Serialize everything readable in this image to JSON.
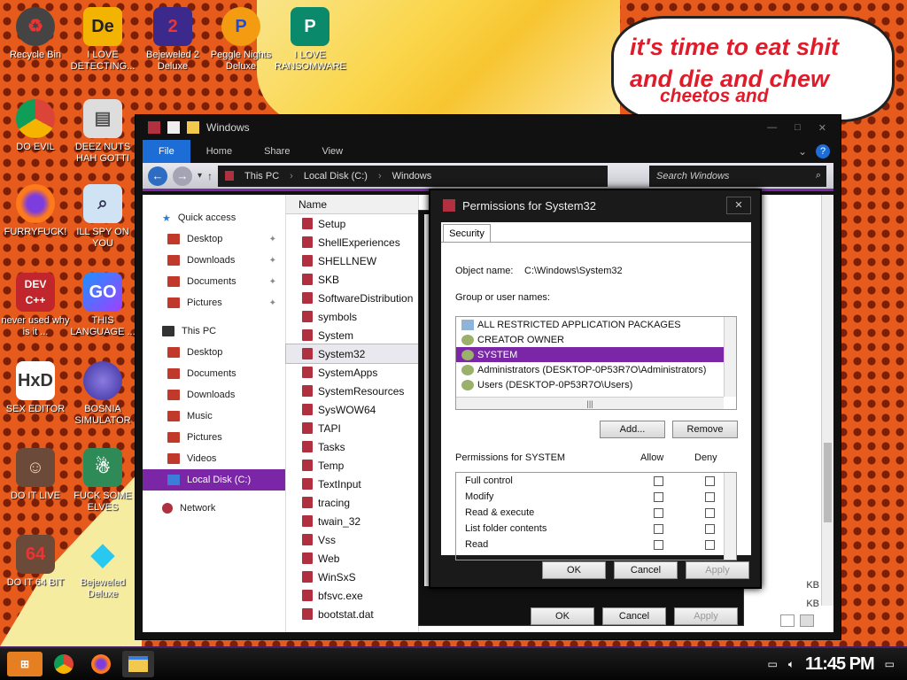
{
  "desktop": {
    "speech_lines": [
      "it's time to eat shit",
      "and die and chew",
      "cheetos and"
    ],
    "icons": [
      {
        "label": "Recycle Bin",
        "icon": "recycle-bin-icon"
      },
      {
        "label": "I LOVE DETECTING...",
        "icon": "detect-it-easy-icon"
      },
      {
        "label": "Bejeweled 2 Deluxe",
        "icon": "bejeweled-2-icon"
      },
      {
        "label": "Peggle Nights Deluxe",
        "icon": "peggle-icon"
      },
      {
        "label": "I LOVE RANSOMWARE",
        "icon": "publisher-icon"
      },
      {
        "label": "DO EVIL",
        "icon": "chrome-icon"
      },
      {
        "label": "DEEZ NUTS HAH GOTTI",
        "icon": "windows-stack-icon"
      },
      {
        "label": "FURRYFUCK!",
        "icon": "firefox-icon"
      },
      {
        "label": "ILL SPY ON YOU",
        "icon": "network-spy-icon"
      },
      {
        "label": "never used why is it ...",
        "icon": "dev-cpp-icon"
      },
      {
        "label": "THIS LANGUAGE ...",
        "icon": "goland-icon"
      },
      {
        "label": "SEX EDITOR",
        "icon": "hxd-icon"
      },
      {
        "label": "BOSNIA SIMULATOR",
        "icon": "mine-icon"
      },
      {
        "label": "DO IT LIVE",
        "icon": "portrait-icon"
      },
      {
        "label": "FUCK SOME ELVES",
        "icon": "santa-icon"
      },
      {
        "label": "DO IT 64 BIT",
        "icon": "portrait-64-icon"
      },
      {
        "label": "Bejeweled Deluxe",
        "icon": "diamond-icon"
      }
    ]
  },
  "explorer": {
    "title": "Windows",
    "tabs": [
      "File",
      "Home",
      "Share",
      "View"
    ],
    "help": "?",
    "breadcrumb": [
      "This PC",
      "Local Disk (C:)",
      "Windows"
    ],
    "search_placeholder": "Search Windows",
    "column_header": "Name",
    "nav": {
      "quick_access": "Quick access",
      "quick_items": [
        "Desktop",
        "Downloads",
        "Documents",
        "Pictures"
      ],
      "this_pc": "This PC",
      "pc_items": [
        "Desktop",
        "Documents",
        "Downloads",
        "Music",
        "Pictures",
        "Videos",
        "Local Disk (C:)"
      ],
      "network": "Network"
    },
    "files": [
      "Setup",
      "ShellExperiences",
      "SHELLNEW",
      "SKB",
      "SoftwareDistribution",
      "symbols",
      "System",
      "System32",
      "SystemApps",
      "SystemResources",
      "SysWOW64",
      "TAPI",
      "Tasks",
      "Temp",
      "TextInput",
      "tracing",
      "twain_32",
      "Vss",
      "Web",
      "WinSxS",
      "bfsvc.exe",
      "bootstat.dat"
    ],
    "selected_file": "System32",
    "kb_labels": [
      "KB",
      "KB"
    ]
  },
  "properties_dialog": {
    "ok": "OK",
    "cancel": "Cancel",
    "apply": "Apply"
  },
  "permissions": {
    "title": "Permissions for System32",
    "close": "✕",
    "tab": "Security",
    "object_label": "Object name:",
    "object_value": "C:\\Windows\\System32",
    "group_label": "Group or user names:",
    "groups": [
      {
        "name": "ALL RESTRICTED APPLICATION PACKAGES",
        "icon": "packages-icon"
      },
      {
        "name": "CREATOR OWNER",
        "icon": "users-icon"
      },
      {
        "name": "SYSTEM",
        "icon": "users-icon"
      },
      {
        "name": "Administrators (DESKTOP-0P53R7O\\Administrators)",
        "icon": "users-icon"
      },
      {
        "name": "Users (DESKTOP-0P53R7O\\Users)",
        "icon": "users-icon"
      }
    ],
    "selected_group": "SYSTEM",
    "add_button": "Add...",
    "remove_button": "Remove",
    "perm_label": "Permissions for SYSTEM",
    "allow": "Allow",
    "deny": "Deny",
    "permissions": [
      "Full control",
      "Modify",
      "Read & execute",
      "List folder contents",
      "Read"
    ],
    "ok": "OK",
    "cancel": "Cancel",
    "apply": "Apply"
  },
  "taskbar": {
    "clock": "11:45 PM",
    "apps": [
      "chrome-icon",
      "firefox-icon",
      "file-explorer-icon"
    ]
  },
  "colors": {
    "accent_purple": "#7a26a6",
    "file_tab_blue": "#1c6ed6",
    "speech_red": "#e01b2a"
  }
}
